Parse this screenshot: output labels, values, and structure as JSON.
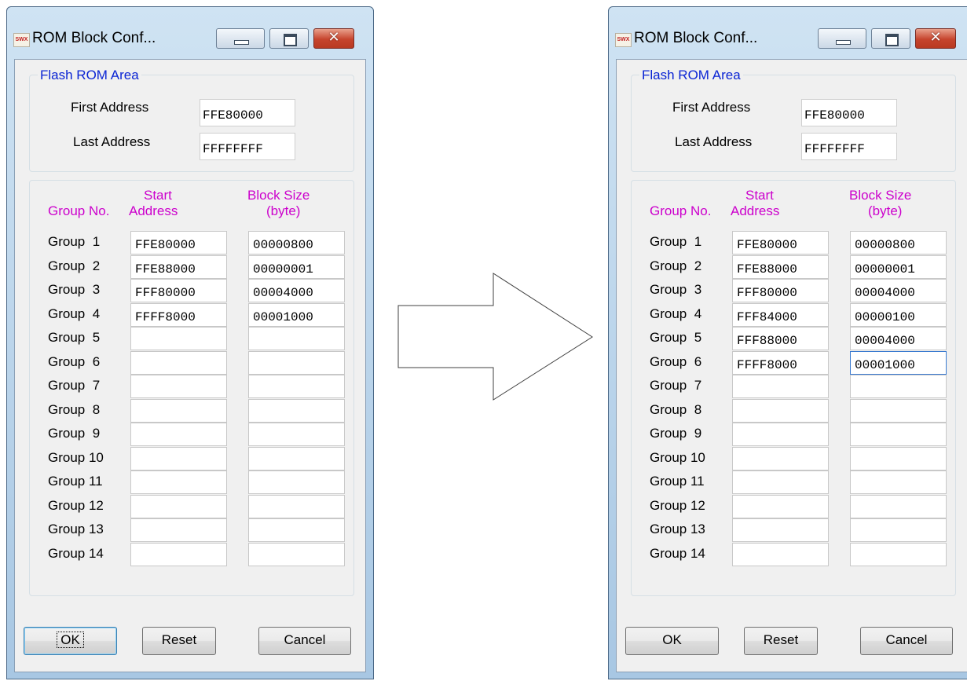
{
  "dialogs": [
    {
      "title": "ROM Block Conf...",
      "app_icon_text": "SWX",
      "flash": {
        "legend": "Flash ROM Area",
        "first_label": "First Address",
        "first_value": "FFE80000",
        "last_label": "Last Address",
        "last_value": "FFFFFFFF"
      },
      "headers": {
        "group": "Group No.",
        "start_1": "Start",
        "start_2": "Address",
        "size_1": "Block Size",
        "size_2": "(byte)"
      },
      "rows": [
        {
          "label": "Group  1",
          "start": "FFE80000",
          "size": "00000800"
        },
        {
          "label": "Group  2",
          "start": "FFE88000",
          "size": "00000001"
        },
        {
          "label": "Group  3",
          "start": "FFF80000",
          "size": "00004000"
        },
        {
          "label": "Group  4",
          "start": "FFFF8000",
          "size": "00001000"
        },
        {
          "label": "Group  5",
          "start": "",
          "size": ""
        },
        {
          "label": "Group  6",
          "start": "",
          "size": ""
        },
        {
          "label": "Group  7",
          "start": "",
          "size": ""
        },
        {
          "label": "Group  8",
          "start": "",
          "size": ""
        },
        {
          "label": "Group  9",
          "start": "",
          "size": ""
        },
        {
          "label": "Group 10",
          "start": "",
          "size": ""
        },
        {
          "label": "Group 11",
          "start": "",
          "size": ""
        },
        {
          "label": "Group 12",
          "start": "",
          "size": ""
        },
        {
          "label": "Group 13",
          "start": "",
          "size": ""
        },
        {
          "label": "Group 14",
          "start": "",
          "size": ""
        }
      ],
      "buttons": {
        "ok": "OK",
        "reset": "Reset",
        "cancel": "Cancel"
      },
      "focus_row": -1,
      "default_ok": true
    },
    {
      "title": "ROM Block Conf...",
      "app_icon_text": "SWX",
      "flash": {
        "legend": "Flash ROM Area",
        "first_label": "First Address",
        "first_value": "FFE80000",
        "last_label": "Last Address",
        "last_value": "FFFFFFFF"
      },
      "headers": {
        "group": "Group No.",
        "start_1": "Start",
        "start_2": "Address",
        "size_1": "Block Size",
        "size_2": "(byte)"
      },
      "rows": [
        {
          "label": "Group  1",
          "start": "FFE80000",
          "size": "00000800"
        },
        {
          "label": "Group  2",
          "start": "FFE88000",
          "size": "00000001"
        },
        {
          "label": "Group  3",
          "start": "FFF80000",
          "size": "00004000"
        },
        {
          "label": "Group  4",
          "start": "FFF84000",
          "size": "00000100"
        },
        {
          "label": "Group  5",
          "start": "FFF88000",
          "size": "00004000"
        },
        {
          "label": "Group  6",
          "start": "FFFF8000",
          "size": "00001000"
        },
        {
          "label": "Group  7",
          "start": "",
          "size": ""
        },
        {
          "label": "Group  8",
          "start": "",
          "size": ""
        },
        {
          "label": "Group  9",
          "start": "",
          "size": ""
        },
        {
          "label": "Group 10",
          "start": "",
          "size": ""
        },
        {
          "label": "Group 11",
          "start": "",
          "size": ""
        },
        {
          "label": "Group 12",
          "start": "",
          "size": ""
        },
        {
          "label": "Group 13",
          "start": "",
          "size": ""
        },
        {
          "label": "Group 14",
          "start": "",
          "size": ""
        }
      ],
      "buttons": {
        "ok": "OK",
        "reset": "Reset",
        "cancel": "Cancel"
      },
      "focus_row": 5,
      "default_ok": false
    }
  ],
  "arrow_icon": "right-arrow"
}
